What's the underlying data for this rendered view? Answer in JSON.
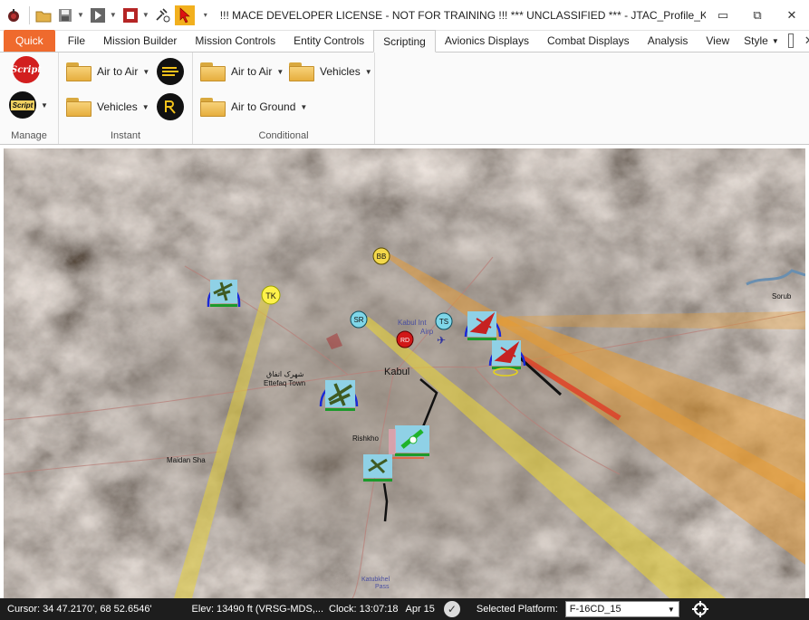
{
  "window": {
    "title": "!!! MACE DEVELOPER LICENSE - NOT FOR TRAINING !!!  *** UNCLASSIFIED ***  - JTAC_Profile_Kab..."
  },
  "tabs": [
    "Quick",
    "File",
    "Mission Builder",
    "Mission Controls",
    "Entity Controls",
    "Scripting",
    "Avionics Displays",
    "Combat Displays",
    "Analysis",
    "View"
  ],
  "active_tab": "Scripting",
  "style_menu": {
    "label": "Style"
  },
  "ribbon": {
    "manage": {
      "label": "Manage",
      "script_icon_text": "Script",
      "script_file_icon_text": "Script"
    },
    "instant": {
      "label": "Instant",
      "air_to_air": "Air to Air",
      "vehicles": "Vehicles"
    },
    "conditional": {
      "label": "Conditional",
      "air_to_air": "Air to Air",
      "vehicles": "Vehicles",
      "air_to_ground": "Air to Ground"
    }
  },
  "map": {
    "place_labels": {
      "kabul": "Kabul",
      "maidan_shar": "Maidan Sha",
      "rishkhor": "Rishkho",
      "sorubi": "Sorub",
      "ettefaq": "Ettefaq Town",
      "ettefaq_native": "شهرک اتفاق",
      "kabul_intl": "Kabul Int",
      "kabul_intl_2": "Airp",
      "katubkhel": "Katubkhel",
      "katubkhel_2": "Pass"
    },
    "markers": {
      "tk": "TK",
      "bb": "BB",
      "sr": "SR",
      "ts": "TS",
      "red": "RD"
    }
  },
  "status_bar": {
    "cursor": "Cursor:  34 47.2170', 68 52.6546'",
    "elev": "Elev:  13490 ft (VRSG-MDS,...",
    "clock": "Clock:  13:07:18",
    "date": "Apr 15",
    "selected_platform_label": "Selected Platform:",
    "selected_platform_value": "F-16CD_15"
  },
  "colors": {
    "quick_tab": "#ef6a2d",
    "status_bar": "#1d1d1d",
    "friendly_arc": "#1a2ad6",
    "beam_yellow": "#e8d23a",
    "beam_orange": "#e79a2f",
    "laser_red": "#e03c26"
  }
}
